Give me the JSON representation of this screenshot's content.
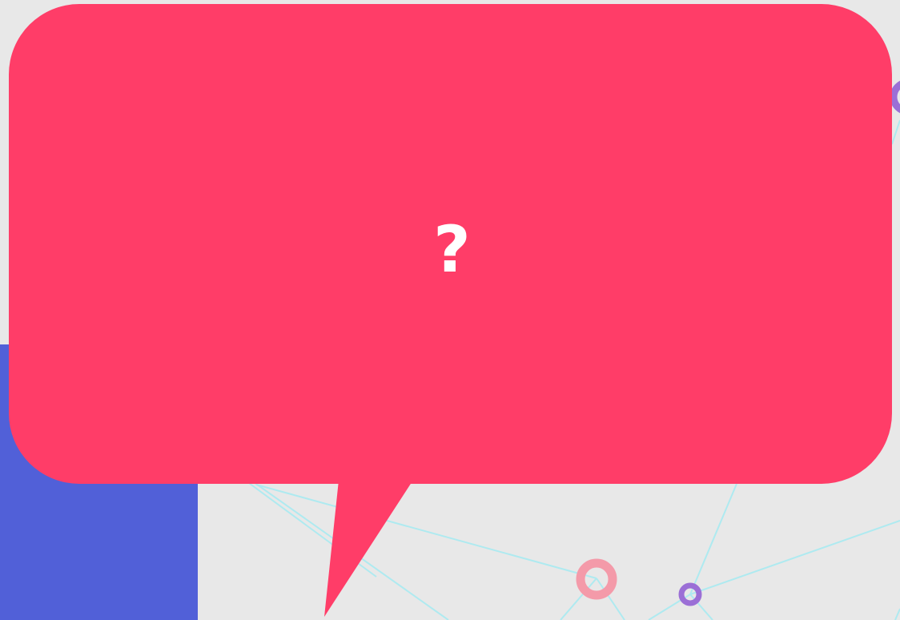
{
  "colors": {
    "background": "#e8e8e8",
    "bubble": "#ff3d68",
    "blue_block": "#5160d8",
    "network_line": "#aeeaf0",
    "node_pink": "#f49aa9",
    "node_purple": "#9b6fd6"
  },
  "bubble": {
    "text": "?"
  },
  "icons": {
    "network": "network-graph-icon",
    "bubble": "speech-bubble-icon"
  }
}
